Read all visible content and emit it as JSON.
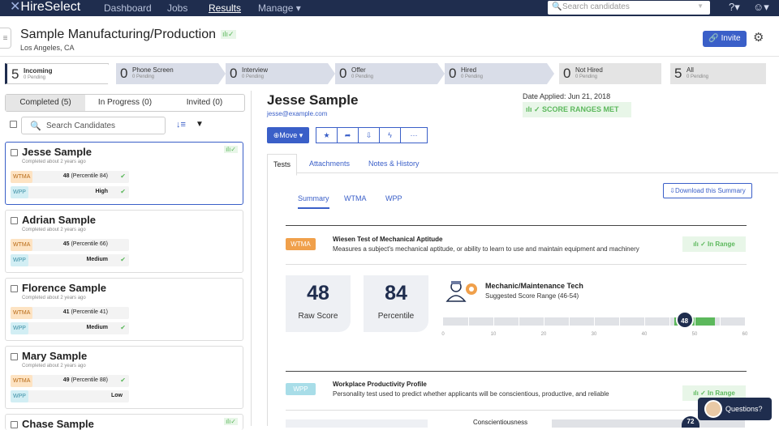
{
  "topnav": {
    "brand": "HireSelect",
    "items": [
      "Dashboard",
      "Jobs",
      "Results",
      "Manage"
    ],
    "active": "Results",
    "search_placeholder": "Search candidates"
  },
  "header": {
    "title": "Sample Manufacturing/Production",
    "location": "Los Angeles, CA",
    "invite_label": "Invite"
  },
  "pipeline": [
    {
      "count": "5",
      "name": "Incoming",
      "sub": "0 Pending"
    },
    {
      "count": "0",
      "name": "Phone Screen",
      "sub": "0 Pending"
    },
    {
      "count": "0",
      "name": "Interview",
      "sub": "0 Pending"
    },
    {
      "count": "0",
      "name": "Offer",
      "sub": "0 Pending"
    },
    {
      "count": "0",
      "name": "Hired",
      "sub": "0 Pending"
    },
    {
      "count": "0",
      "name": "Not Hired",
      "sub": "0 Pending"
    },
    {
      "count": "5",
      "name": "All",
      "sub": "0 Pending"
    }
  ],
  "left": {
    "tabs": [
      "Completed (5)",
      "In Progress (0)",
      "Invited (0)"
    ],
    "search_label": "Search Candidates",
    "candidates": [
      {
        "name": "Jesse Sample",
        "completed": "Completed about 2 years ago",
        "wtma_score": "48",
        "wtma_pct": "(Percentile 84)",
        "wpp": "High",
        "wpp_ok": true
      },
      {
        "name": "Adrian Sample",
        "completed": "Completed about 2 years ago",
        "wtma_score": "45",
        "wtma_pct": "(Percentile 66)",
        "wpp": "Medium",
        "wpp_ok": true
      },
      {
        "name": "Florence Sample",
        "completed": "Completed about 2 years ago",
        "wtma_score": "41",
        "wtma_pct": "(Percentile 41)",
        "wpp": "Medium",
        "wpp_ok": true
      },
      {
        "name": "Mary Sample",
        "completed": "Completed about 2 years ago",
        "wtma_score": "49",
        "wtma_pct": "(Percentile 88)",
        "wpp": "Low",
        "wpp_ok": false
      },
      {
        "name": "Chase Sample"
      }
    ]
  },
  "detail": {
    "name": "Jesse Sample",
    "email": "jesse@example.com",
    "date_applied": "Date Applied: Jun 21, 2018",
    "score_ranges": "SCORE RANGES MET",
    "move_label": "Move",
    "tabs": [
      "Tests",
      "Attachments",
      "Notes & History"
    ],
    "subtabs": [
      "Summary",
      "WTMA",
      "WPP"
    ],
    "download_label": "Download this Summary",
    "wtma": {
      "badge": "WTMA",
      "title": "Wiesen Test of Mechanical Aptitude",
      "desc": "Measures a subject's mechanical aptitude, or ability to learn to use and maintain equipment and machinery",
      "in_range": "In Range",
      "raw_score": "48",
      "raw_label": "Raw Score",
      "percentile": "84",
      "percentile_label": "Percentile",
      "role": "Mechanic/Maintenance Tech",
      "range_text": "Suggested Score Range (46-54)",
      "bar_min": 0,
      "bar_max": 60,
      "range_lo": 46,
      "range_hi": 54,
      "marker": "48",
      "ticks": [
        "0",
        "10",
        "20",
        "30",
        "40",
        "50",
        "60"
      ]
    },
    "wpp": {
      "badge": "WPP",
      "title": "Workplace Productivity Profile",
      "desc": "Personality test used to predict whether applicants will be conscientious, productive, and reliable",
      "in_range": "In Range",
      "trait": "Conscientiousness",
      "marker": "72"
    }
  },
  "questions_label": "Questions?",
  "colors": {
    "navy": "#1f2d4e",
    "accent": "#3a5fc8",
    "green": "#5cb85c",
    "wtma": "#f0a04b",
    "wpp": "#6cc3d5"
  }
}
